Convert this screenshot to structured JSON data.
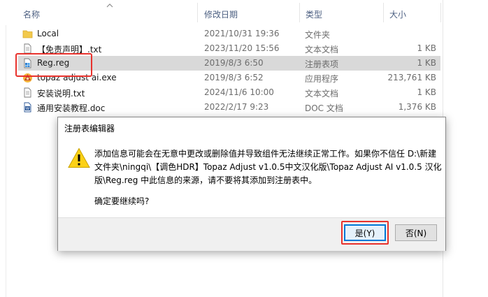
{
  "columns": {
    "name": "名称",
    "date": "修改日期",
    "type": "类型",
    "size": "大小"
  },
  "files": [
    {
      "name": "Local",
      "date": "2021/10/31 19:36",
      "type": "文件夹",
      "size": "",
      "icon": "folder-icon"
    },
    {
      "name": "【免责声明】.txt",
      "date": "2023/11/20 15:56",
      "type": "文本文档",
      "size": "1 KB",
      "icon": "text-file-icon"
    },
    {
      "name": "Reg.reg",
      "date": "2019/8/3 6:50",
      "type": "注册表项",
      "size": "1 KB",
      "icon": "registry-file-icon"
    },
    {
      "name": "topaz adjust ai.exe",
      "date": "2019/8/3 6:52",
      "type": "应用程序",
      "size": "213,761 KB",
      "icon": "app-icon"
    },
    {
      "name": "安装说明.txt",
      "date": "2024/11/6 10:00",
      "type": "文本文档",
      "size": "1 KB",
      "icon": "text-file-icon"
    },
    {
      "name": "通用安装教程.doc",
      "date": "2022/2/17 9:23",
      "type": "DOC 文档",
      "size": "1,376 KB",
      "icon": "doc-file-icon"
    }
  ],
  "dialog": {
    "title": "注册表编辑器",
    "message_lines": [
      "添加信息可能会在无意中更改或删除值并导致组件无法继续正常工作。如果你不信任 D:\\新建",
      "文件夹\\ningqi\\【调色HDR】Topaz Adjust v1.0.5中文汉化版\\Topaz Adjust AI v1.0.5 汉化",
      "版\\Reg.reg 中此信息的来源，请不要将其添加到注册表中。"
    ],
    "question": "确定要继续吗?",
    "yes_label": "是(Y)",
    "no_label": "否(N)",
    "icon": "warning-icon"
  },
  "colors": {
    "highlight": "#e8322d",
    "selected_row": "#d9d9d9",
    "header_text": "#4d6082",
    "folder": "#f2c94c",
    "default_button_border": "#0078d7"
  }
}
